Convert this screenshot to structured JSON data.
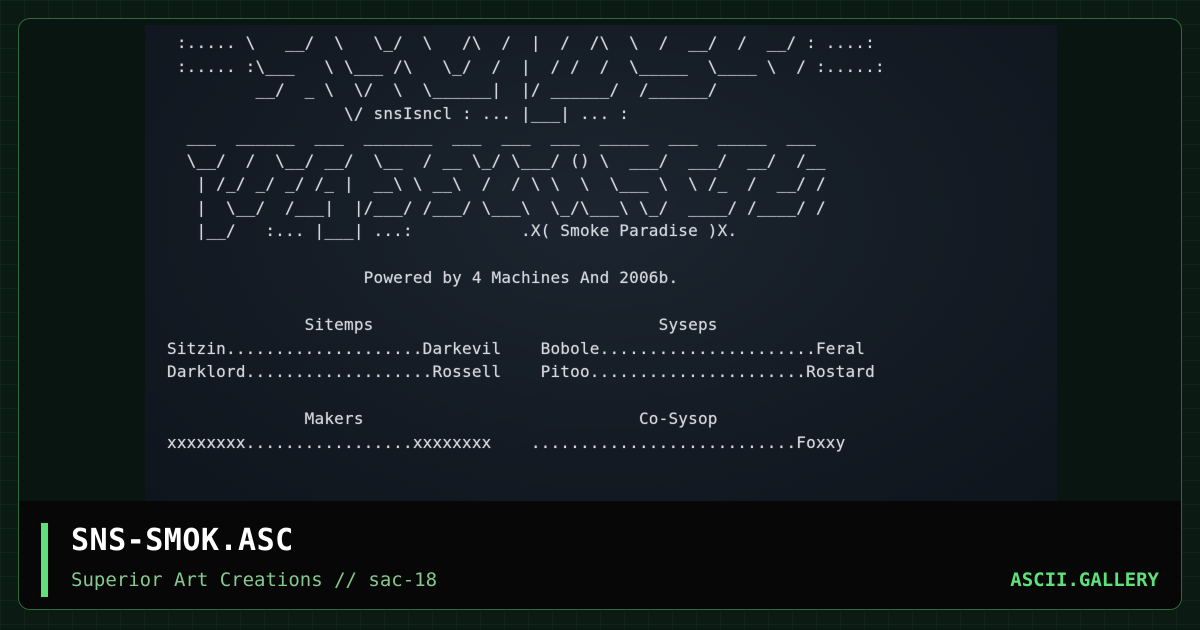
{
  "artwork": {
    "lines": [
      " :..... \\   __/  \\   \\_/  \\   /\\  /  |  /  /\\  \\  /  __/  /  __/ : ....:",
      " :..... :\\___   \\ \\___ /\\   \\_/  /  |  / /  /  \\_____  \\____ \\  / :.....:",
      "         __/  _ \\  \\/  \\  \\______|  |/ ______/  /______/",
      "                  \\/ snsIsncl : ... |___| ... :",
      "  ___  ______  ___  _______  ___  ___  ___  _____  ___  _____  ___",
      "  \\__/  /  \\__/ __/  \\__  / __ \\_/ \\___/ () \\  ___/  ___/  __/  /__",
      "   | /_/ _/ _/ /_ |  __\\ \\ __\\  /  / \\ \\  \\  \\___ \\  \\ /_  /  __/ /",
      "   |  \\__/  /___|  |/___/ /___/ \\___\\  \\_/\\___\\ \\_/  ____/ /____/ /",
      "   |__/   :... |___| ...:           .X( Smoke Paradise )X.",
      "",
      "                    Powered by 4 Machines And 2006b.",
      "",
      "              Sitemps                             Syseps",
      "Sitzin....................Darkevil    Bobole......................Feral",
      "Darklord...................Rossell    Pitoo......................Rostard",
      "",
      "              Makers                            Co-Sysop",
      "xxxxxxxx.................xxxxxxxx    ...........................Foxxy"
    ]
  },
  "footer": {
    "title": "SNS-SMOK.ASC",
    "subtitle": "Superior Art Creations // sac-18",
    "brand": "ASCII.GALLERY"
  },
  "colors": {
    "accent": "#5ee07a",
    "subtitle": "#86c98f",
    "border": "#2f6a3f"
  }
}
